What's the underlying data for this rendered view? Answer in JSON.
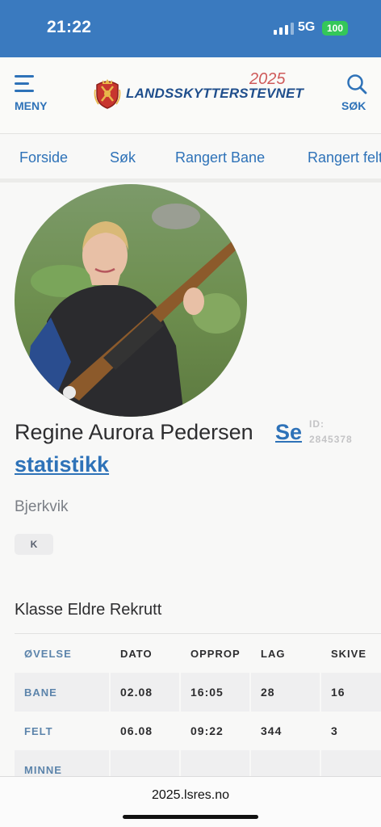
{
  "status_bar": {
    "time": "21:22",
    "network": "5G",
    "battery": "100"
  },
  "header": {
    "menu_label": "MENY",
    "search_label": "SØK",
    "logo_year": "2025",
    "logo_text": "LANDSSKYTTERSTEVNET"
  },
  "tabs": [
    "Forside",
    "Søk",
    "Rangert Bane",
    "Rangert felt"
  ],
  "profile": {
    "name": "Regine Aurora Pedersen",
    "stats_link_part1": "Se",
    "stats_link_part2": "statistikk",
    "id_label": "ID:",
    "id_value": "2845378",
    "club": "Bjerkvik",
    "badge": "K"
  },
  "class_title": "Klasse Eldre Rekrutt",
  "schedule": {
    "headers": [
      "ØVELSE",
      "DATO",
      "OPPROP",
      "LAG",
      "SKIVE"
    ],
    "rows": [
      [
        "BANE",
        "02.08",
        "16:05",
        "28",
        "16"
      ],
      [
        "FELT",
        "06.08",
        "09:22",
        "344",
        "3"
      ],
      [
        "MINNE",
        "",
        "",
        "",
        ""
      ]
    ]
  },
  "browser": {
    "url": "2025.lsres.no"
  },
  "colors": {
    "status_bar": "#3a7abf",
    "link": "#2e72b8",
    "accent_year": "#cf5a5a"
  }
}
